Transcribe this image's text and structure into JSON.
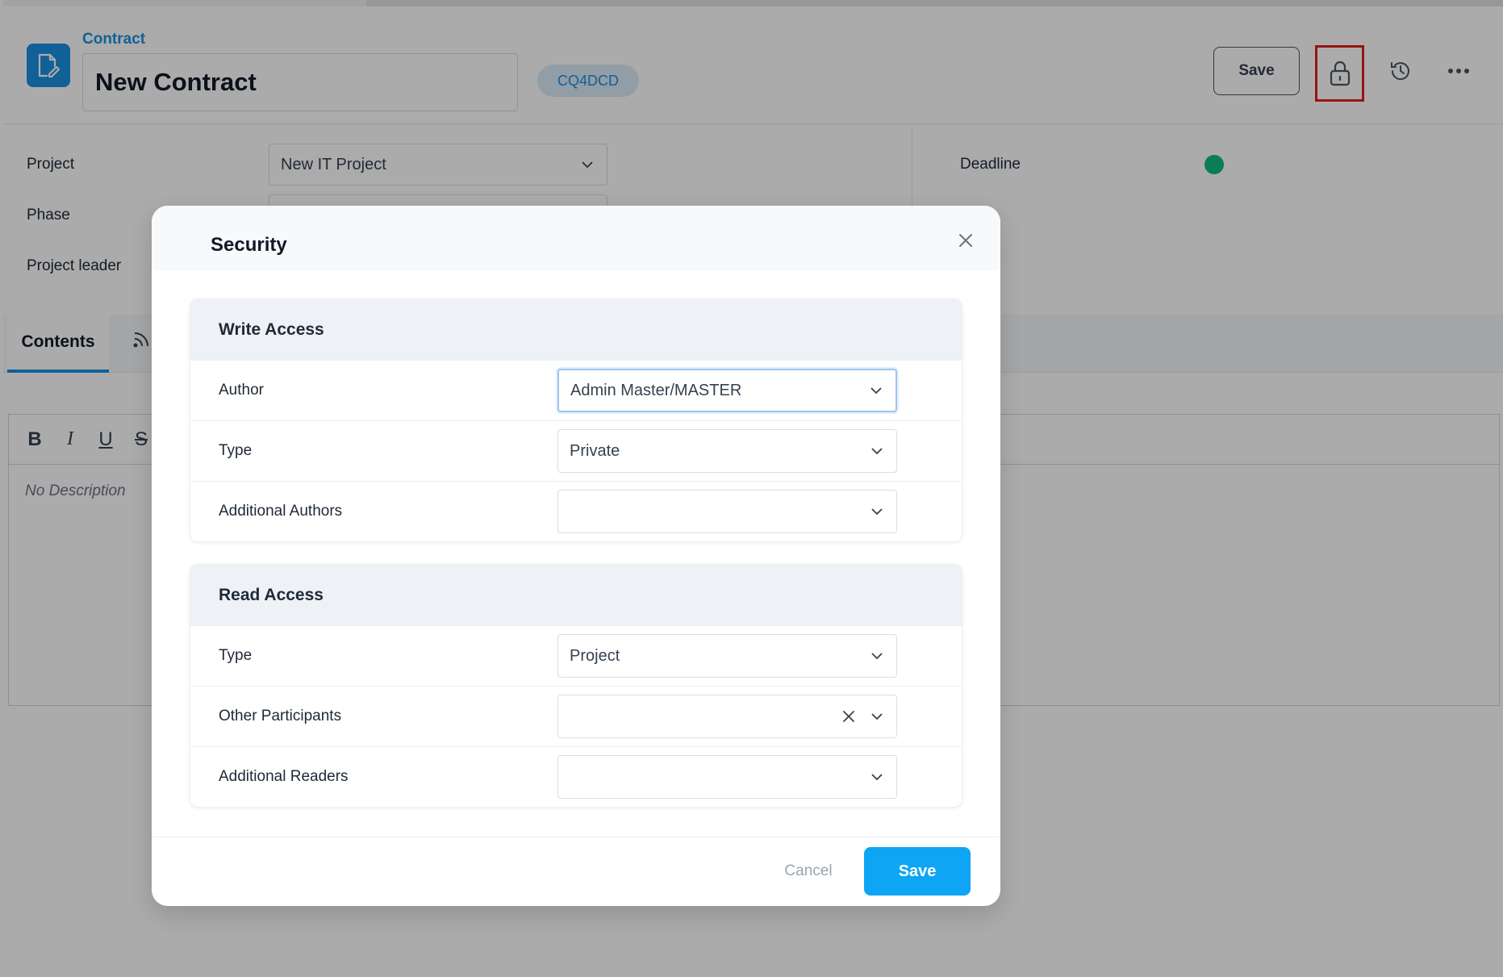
{
  "header": {
    "breadcrumb": "Contract",
    "title": "New Contract",
    "code": "CQ4DCD",
    "save_label": "Save",
    "icons": [
      "document-edit-icon",
      "lock-icon",
      "history-icon",
      "more-icon"
    ]
  },
  "fields": {
    "project_label": "Project",
    "project_value": "New IT Project",
    "phase_label": "Phase",
    "project_leader_label": "Project leader",
    "deadline_label": "Deadline",
    "deadline_status_color": "#10b981"
  },
  "tabs": {
    "contents_label": "Contents"
  },
  "editor": {
    "toolbar": [
      "B",
      "I",
      "U",
      "S"
    ],
    "placeholder": "No Description"
  },
  "modal": {
    "title": "Security",
    "write_access": {
      "heading": "Write Access",
      "rows": [
        {
          "label": "Author",
          "value": "Admin Master/MASTER"
        },
        {
          "label": "Type",
          "value": "Private"
        },
        {
          "label": "Additional Authors",
          "value": ""
        }
      ]
    },
    "read_access": {
      "heading": "Read Access",
      "rows": [
        {
          "label": "Type",
          "value": "Project"
        },
        {
          "label": "Other Participants",
          "value": ""
        },
        {
          "label": "Additional Readers",
          "value": ""
        }
      ]
    },
    "cancel_label": "Cancel",
    "save_label": "Save"
  },
  "colors": {
    "accent": "#1a8fe3",
    "primary_button": "#0ea5f4",
    "highlight_outline": "#e0201b"
  }
}
